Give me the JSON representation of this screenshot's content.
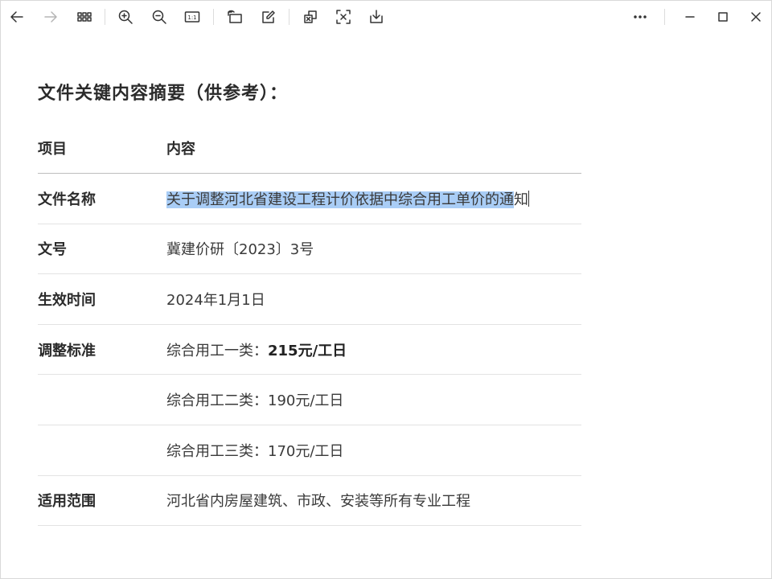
{
  "toolbar": {
    "back": "back-arrow-icon",
    "forward": "forward-arrow-icon",
    "grid": "thumbnail-grid-icon",
    "zoom_in": "zoom-in-icon",
    "zoom_out": "zoom-out-icon",
    "actual_size": "actual-size-icon",
    "actual_size_label": "1:1",
    "rotate": "rotate-icon",
    "edit": "edit-icon",
    "copy_ocr": "copy-icon",
    "extract": "extract-icon",
    "save": "save-icon",
    "more": "more-icon",
    "minimize": "minimize-icon",
    "maximize": "maximize-icon",
    "close": "close-icon"
  },
  "document": {
    "title": "文件关键内容摘要（供参考）：",
    "header": {
      "col_item": "项目",
      "col_content": "内容"
    },
    "rows": [
      {
        "key": "文件名称",
        "value": "关于调整河北省建设工程计价依据中综合用工单价的通知",
        "value_highlighted": "关于调整河北省建设工程计价依据中综合用工单价的通",
        "value_rest": "知"
      },
      {
        "key": "文号",
        "value": "冀建价研〔2023〕3号"
      },
      {
        "key": "生效时间",
        "value": "2024年1月1日"
      },
      {
        "key": "调整标准",
        "value_prefix": "综合用工一类：",
        "value_bold": "215元/工日"
      },
      {
        "key": "",
        "value": "综合用工二类：190元/工日"
      },
      {
        "key": "",
        "value": "综合用工三类：170元/工日"
      },
      {
        "key": "适用范围",
        "value": "河北省内房屋建筑、市政、安装等所有专业工程"
      }
    ]
  },
  "colors": {
    "selection": "#a9cdf6",
    "divider": "#e3e3e3"
  }
}
